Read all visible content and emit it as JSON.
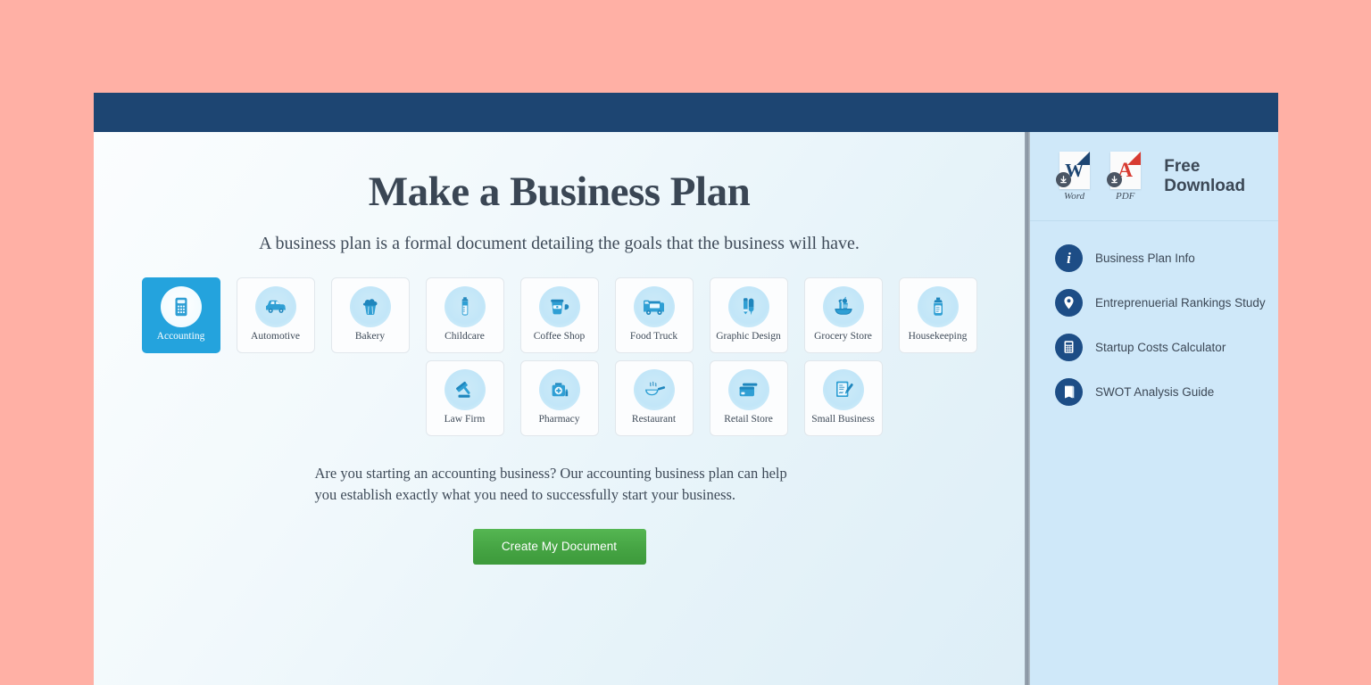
{
  "page": {
    "background_color": "#ffb0a5",
    "topbar_color": "#1d4572",
    "sidebar_color": "#cfe8f9",
    "accent_color": "#24a3dd",
    "cta_color": "#46a544"
  },
  "main": {
    "headline": "Make a Business Plan",
    "subheadline": "A business plan is a formal document detailing the goals that the business will have.",
    "description": "Are you starting an accounting business? Our accounting business plan can help you establish exactly what you need to successfully start your business.",
    "cta_label": "Create My Document"
  },
  "categories": {
    "row1": [
      {
        "label": "Accounting",
        "icon": "calculator-icon",
        "selected": true
      },
      {
        "label": "Automotive",
        "icon": "car-icon",
        "selected": false
      },
      {
        "label": "Bakery",
        "icon": "cupcake-icon",
        "selected": false
      },
      {
        "label": "Childcare",
        "icon": "baby-bottle-icon",
        "selected": false
      },
      {
        "label": "Coffee Shop",
        "icon": "coffee-cup-icon",
        "selected": false
      },
      {
        "label": "Food Truck",
        "icon": "food-truck-icon",
        "selected": false
      },
      {
        "label": "Graphic Design",
        "icon": "pencil-brush-icon",
        "selected": false
      },
      {
        "label": "Grocery Store",
        "icon": "grocery-bag-icon",
        "selected": false
      },
      {
        "label": "Housekeeping",
        "icon": "spray-bottle-icon",
        "selected": false
      }
    ],
    "row2": [
      {
        "label": "Law Firm",
        "icon": "gavel-icon",
        "selected": false
      },
      {
        "label": "Pharmacy",
        "icon": "medical-kit-icon",
        "selected": false
      },
      {
        "label": "Restaurant",
        "icon": "skillet-icon",
        "selected": false
      },
      {
        "label": "Retail Store",
        "icon": "credit-card-icon",
        "selected": false
      },
      {
        "label": "Small Business",
        "icon": "contract-pen-icon",
        "selected": false
      }
    ]
  },
  "sidebar": {
    "download": {
      "title": "Free Download",
      "items": [
        {
          "caption": "Word",
          "glyph": "W",
          "icon": "word-document-icon"
        },
        {
          "caption": "PDF",
          "glyph": "A",
          "icon": "pdf-document-icon"
        }
      ]
    },
    "links": [
      {
        "label": "Business Plan Info",
        "icon": "info-icon"
      },
      {
        "label": "Entreprenuerial Rankings Study",
        "icon": "location-pin-icon"
      },
      {
        "label": "Startup Costs Calculator",
        "icon": "calculator-icon"
      },
      {
        "label": "SWOT Analysis Guide",
        "icon": "book-icon"
      }
    ]
  }
}
